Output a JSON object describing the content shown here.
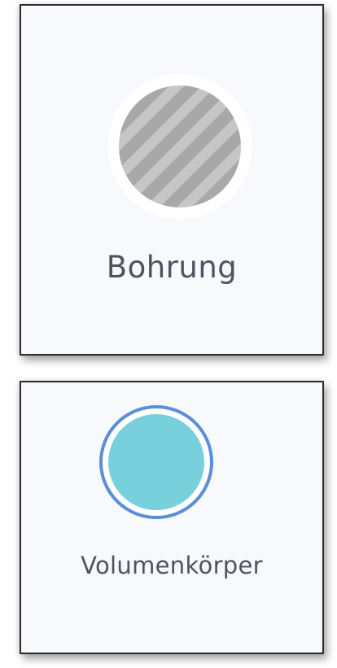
{
  "cards": [
    {
      "label": "Bohrung",
      "icon": "hatched-circle-icon",
      "colors": {
        "hatch_dark": "#a8a8a8",
        "hatch_light": "#c6c6c6",
        "text": "#4b5461"
      }
    },
    {
      "label": "Volumenkörper",
      "icon": "solid-body-circle-icon",
      "colors": {
        "fill": "#78d0dc",
        "outline": "#5b8ed8",
        "text": "#4b5461"
      }
    }
  ]
}
